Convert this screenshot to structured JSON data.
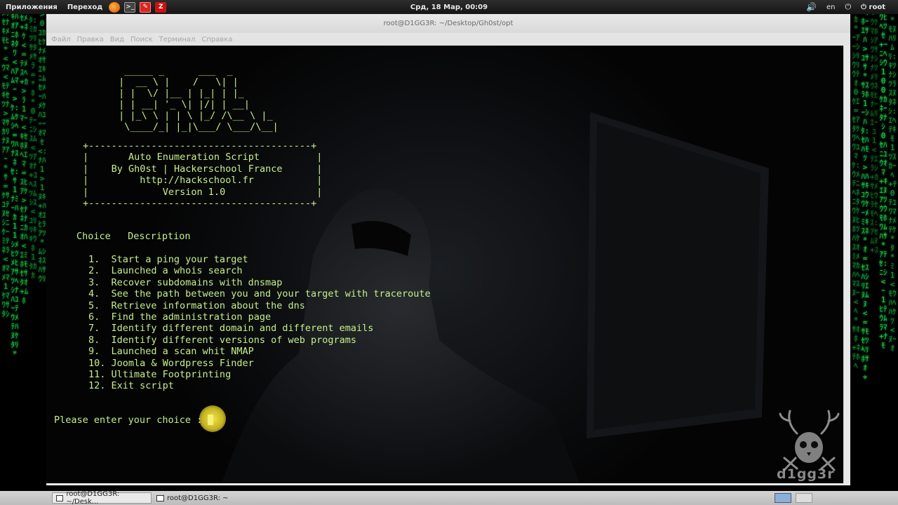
{
  "top_panel": {
    "applications_menu": "Приложения",
    "places_menu": "Переход",
    "launchers": [
      "firefox-icon",
      "terminal-icon",
      "editor-icon",
      "filezilla-icon"
    ],
    "clock": "Срд, 18 Мар, 00:09",
    "keyboard_layout": "en",
    "user": "root"
  },
  "window": {
    "title": "root@D1GG3R: ~/Desktop/Gh0st/opt",
    "menu": [
      "Файл",
      "Правка",
      "Вид",
      "Поиск",
      "Терминал",
      "Справка"
    ]
  },
  "terminal": {
    "banner": [
      "  _____ _      ___  _",
      " |  __ \\ |    /   \\| |",
      " | |  \\/ |__ | |_| | |_",
      " | | __| '_ \\| |/| | __|",
      " | |_\\ \\ | | \\ |_/ /\\__ \\ |_",
      "  \\____/_| |_|\\___/ \\___/\\__|"
    ],
    "box_border": "+---------------------------------------+",
    "box_lines": [
      "|       Auto Enumeration Script          |",
      "|    By Gh0st | Hackerschool France      |",
      "|         http://hackschool.fr           |",
      "|             Version 1.0                |"
    ],
    "header": "Choice   Description",
    "options": [
      "1.  Start a ping your target",
      "2.  Launched a whois search",
      "3.  Recover subdomains with dnsmap",
      "4.  See the path between you and your target with traceroute",
      "5.  Retrieve information about the dns",
      "6.  Find the administration page",
      "7.  Identify different domain and different emails",
      "8.  Identify different versions of web programs",
      "9.  Launched a scan whit NMAP",
      "10. Joomla & Wordpress Finder",
      "11. Ultimate Footprinting",
      "12. Exit script"
    ],
    "prompt": "Please enter your choice : "
  },
  "watermark": "d1gg3r",
  "taskbar": {
    "tasks": [
      "root@D1GG3R: ~/Desk...",
      "root@D1GG3R: ~"
    ]
  },
  "colors": {
    "terminal_text": "#c7ef8a",
    "matrix_green": "#27e63a",
    "cursor_highlight": "#f4e040"
  }
}
